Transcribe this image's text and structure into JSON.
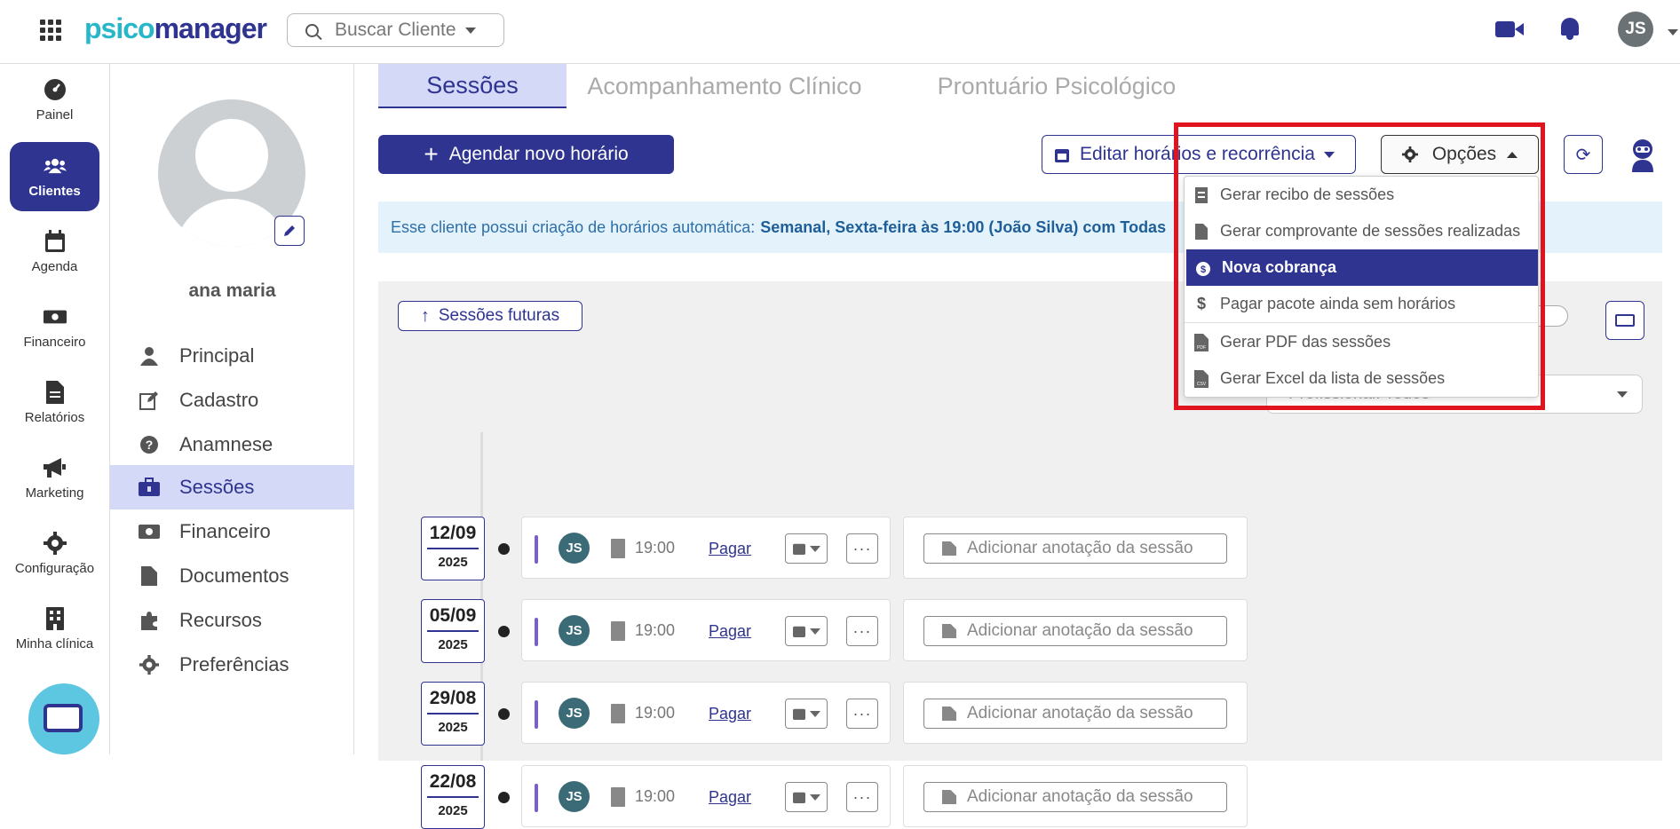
{
  "header": {
    "logo_part1": "psico",
    "logo_part2": "manager",
    "search_placeholder": "Buscar Cliente",
    "user_initials": "JS"
  },
  "leftnav": {
    "items": [
      {
        "label": "Painel",
        "icon": "gauge-icon"
      },
      {
        "label": "Clientes",
        "icon": "users-icon"
      },
      {
        "label": "Agenda",
        "icon": "calendar-icon"
      },
      {
        "label": "Financeiro",
        "icon": "money-icon"
      },
      {
        "label": "Relatórios",
        "icon": "document-icon"
      },
      {
        "label": "Marketing",
        "icon": "megaphone-icon"
      },
      {
        "label": "Configuração",
        "icon": "gear-icon"
      },
      {
        "label": "Minha clínica",
        "icon": "building-icon"
      }
    ]
  },
  "profile": {
    "name": "ana maria",
    "menu": [
      {
        "label": "Principal",
        "icon": "user-icon"
      },
      {
        "label": "Cadastro",
        "icon": "edit-icon"
      },
      {
        "label": "Anamnese",
        "icon": "question-icon"
      },
      {
        "label": "Sessões",
        "icon": "briefcase-icon"
      },
      {
        "label": "Financeiro",
        "icon": "money-icon"
      },
      {
        "label": "Documentos",
        "icon": "file-icon"
      },
      {
        "label": "Recursos",
        "icon": "puzzle-icon"
      },
      {
        "label": "Preferências",
        "icon": "gear-icon"
      }
    ]
  },
  "tabs": [
    "Sessões",
    "Acompanhamento Clínico",
    "Prontuário Psicológico"
  ],
  "toolbar": {
    "new_schedule": "Agendar novo horário",
    "edit_recurrence": "Editar horários e recorrência",
    "options": "Opções"
  },
  "banner": {
    "text": "Esse cliente possui criação de horários automática:",
    "bold": "Semanal, Sexta-feira às 19:00 (João Silva) com Todas"
  },
  "panel": {
    "future_sessions": "Sessões futuras",
    "professional_select": "Profissional: Todos"
  },
  "sessions": [
    {
      "date": "12/09",
      "year": "2025",
      "initials": "JS",
      "time": "19:00",
      "pay": "Pagar",
      "note": "Adicionar anotação da sessão"
    },
    {
      "date": "05/09",
      "year": "2025",
      "initials": "JS",
      "time": "19:00",
      "pay": "Pagar",
      "note": "Adicionar anotação da sessão"
    },
    {
      "date": "29/08",
      "year": "2025",
      "initials": "JS",
      "time": "19:00",
      "pay": "Pagar",
      "note": "Adicionar anotação da sessão"
    },
    {
      "date": "22/08",
      "year": "2025",
      "initials": "JS",
      "time": "19:00",
      "pay": "Pagar",
      "note": "Adicionar anotação da sessão"
    }
  ],
  "dropdown": {
    "items": [
      {
        "label": "Gerar recibo de sessões",
        "icon": "receipt-icon"
      },
      {
        "label": "Gerar comprovante de sessões realizadas",
        "icon": "file-icon"
      },
      {
        "label": "Nova cobrança",
        "icon": "money-bag-icon"
      },
      {
        "label": "Pagar pacote ainda sem horários",
        "icon": "dollar-icon"
      },
      {
        "label": "Gerar PDF das sessões",
        "icon": "pdf-file-icon"
      },
      {
        "label": "Gerar Excel da lista de sessões",
        "icon": "csv-file-icon"
      }
    ]
  },
  "colors": {
    "brand": "#2f3491",
    "accent": "#27b7c9",
    "highlight": "#e0141e"
  }
}
